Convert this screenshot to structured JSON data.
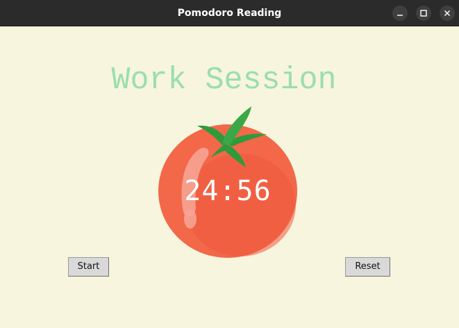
{
  "window": {
    "title": "Pomodoro Reading"
  },
  "session": {
    "title": "Work Session",
    "timer": "24:56"
  },
  "buttons": {
    "start_label": "Start",
    "reset_label": "Reset"
  },
  "icons": {
    "minimize": "minimize-icon",
    "maximize": "maximize-icon",
    "close": "close-icon",
    "tomato": "tomato-image"
  },
  "colors": {
    "background": "#f7f5dd",
    "title_text": "#9bdeac",
    "tomato_body": "#f26849",
    "tomato_leaves": "#2f9a3b",
    "timer_text": "#ffffff"
  }
}
